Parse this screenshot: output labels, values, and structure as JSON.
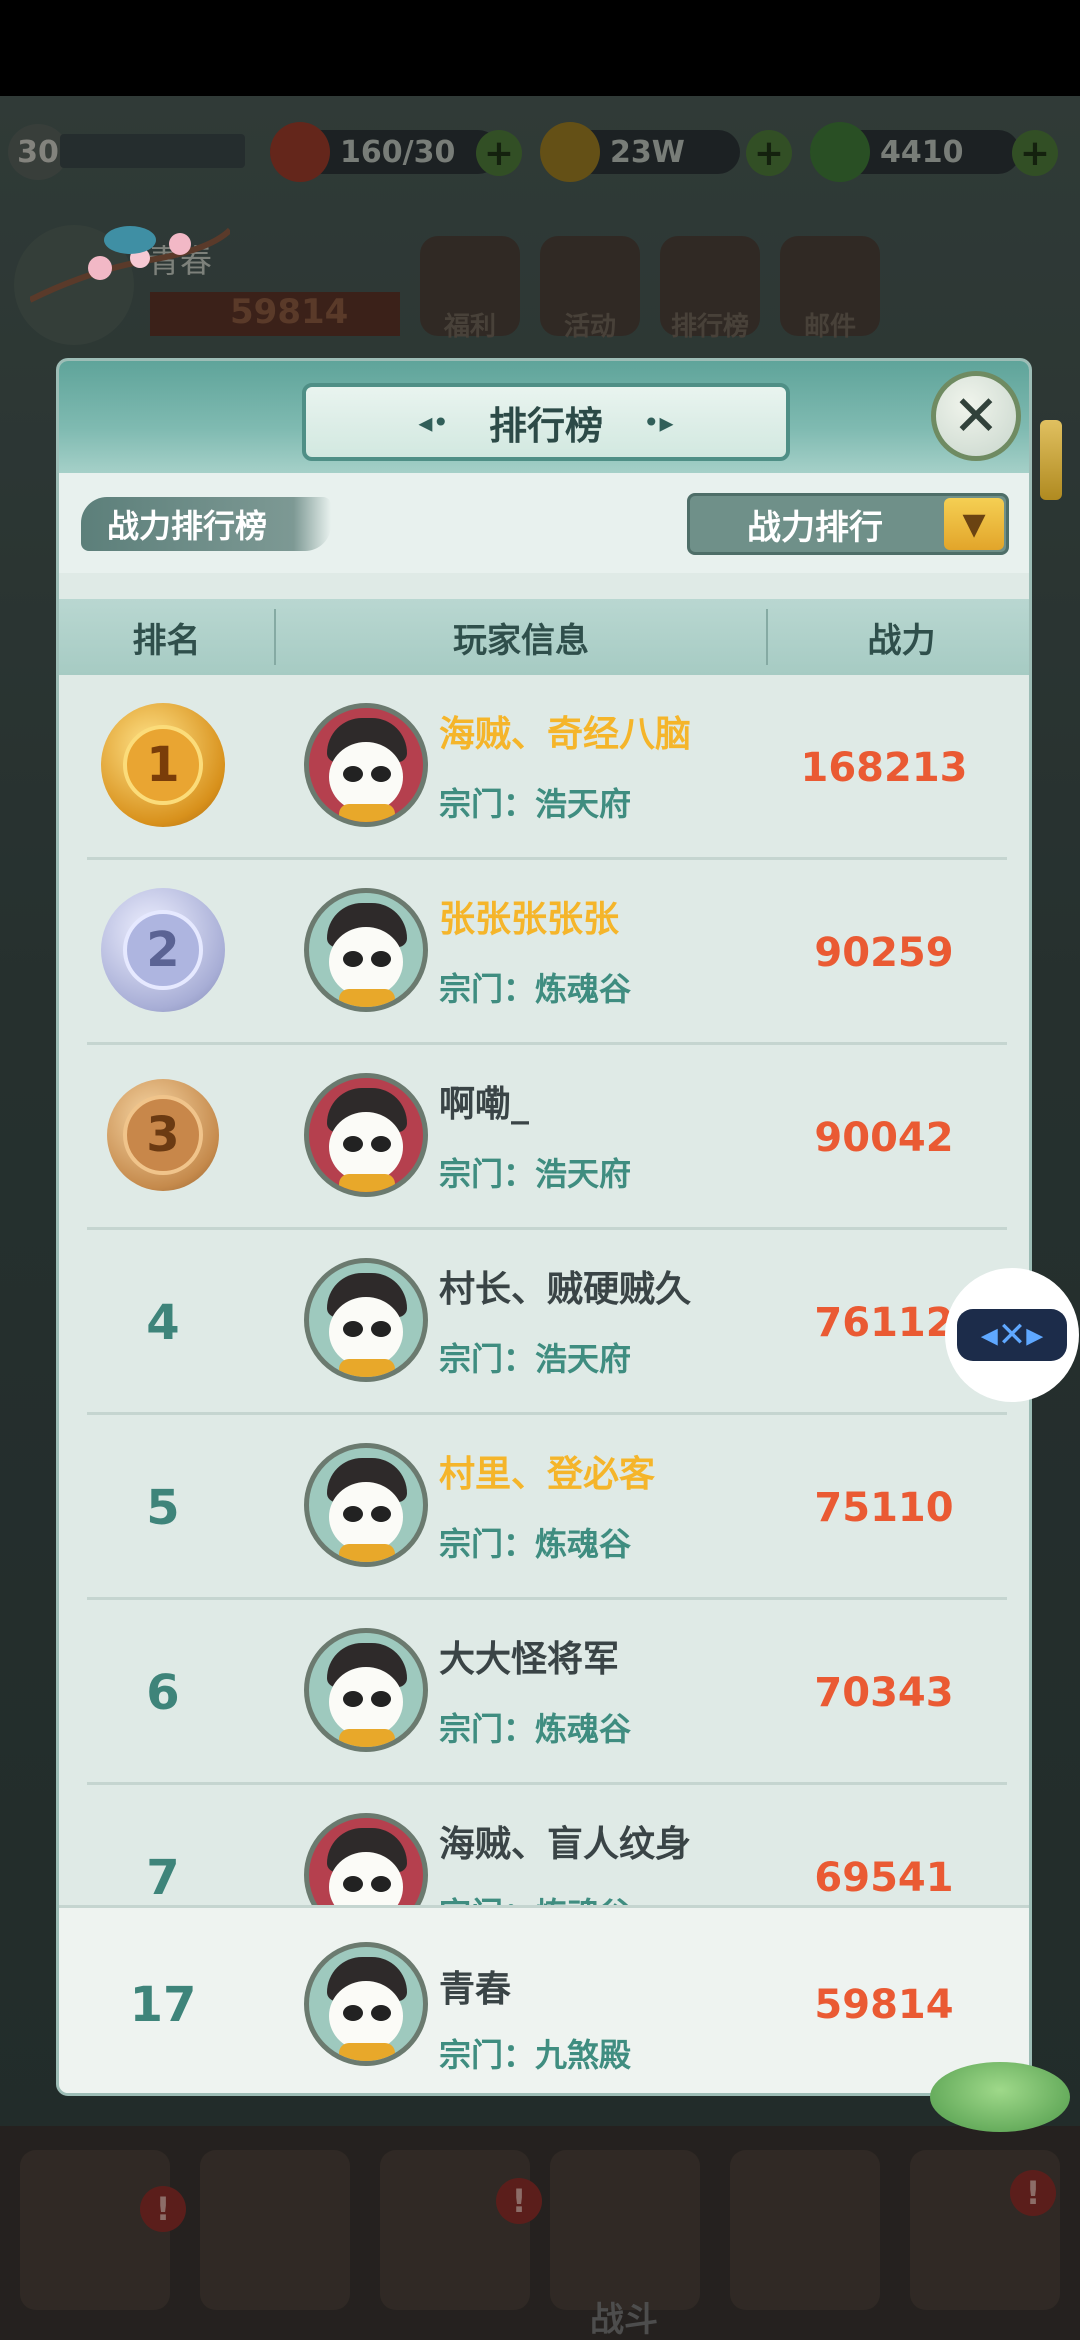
{
  "background": {
    "level": "30",
    "resources": [
      {
        "value": "160/30"
      },
      {
        "value": "23W"
      },
      {
        "value": "4410"
      }
    ],
    "player_name": "青春",
    "player_power": "59814",
    "menu_labels": [
      "福利",
      "活动",
      "排行榜",
      "邮件"
    ],
    "battle_label": "战斗",
    "nav_badge": "!"
  },
  "modal": {
    "title": "排行榜",
    "category_label": "战力排行榜",
    "sort": {
      "selected": "战力排行"
    },
    "columns": {
      "rank": "排名",
      "player_info": "玩家信息",
      "power": "战力"
    },
    "rows": [
      {
        "rank": "1",
        "medal": "gold",
        "name": "海贼、奇经八脑",
        "name_color": "gold",
        "sect": "宗门：浩天府",
        "power": "168213",
        "avatar": "pink"
      },
      {
        "rank": "2",
        "medal": "silver",
        "name": "张张张张张",
        "name_color": "gold",
        "sect": "宗门：炼魂谷",
        "power": "90259",
        "avatar": "teal"
      },
      {
        "rank": "3",
        "medal": "bronze",
        "name": "啊嘞_",
        "name_color": "dark",
        "sect": "宗门：浩天府",
        "power": "90042",
        "avatar": "pink"
      },
      {
        "rank": "4",
        "medal": "",
        "name": "村长、贼硬贼久",
        "name_color": "dark",
        "sect": "宗门：浩天府",
        "power": "76112",
        "avatar": "teal"
      },
      {
        "rank": "5",
        "medal": "",
        "name": "村里、登必客",
        "name_color": "gold",
        "sect": "宗门：炼魂谷",
        "power": "75110",
        "avatar": "teal"
      },
      {
        "rank": "6",
        "medal": "",
        "name": "大大怪将军",
        "name_color": "dark",
        "sect": "宗门：炼魂谷",
        "power": "70343",
        "avatar": "teal"
      },
      {
        "rank": "7",
        "medal": "",
        "name": "海贼、盲人纹身",
        "name_color": "dark",
        "sect": "宗门：炼魂谷",
        "power": "69541",
        "avatar": "pink"
      }
    ],
    "self_row": {
      "rank": "17",
      "name": "青春",
      "sect": "宗门：九煞殿",
      "power": "59814"
    }
  },
  "colors": {
    "accent_teal": "#3f8d80",
    "power_orange": "#ea5a33",
    "gold_name": "#f5b52a"
  }
}
